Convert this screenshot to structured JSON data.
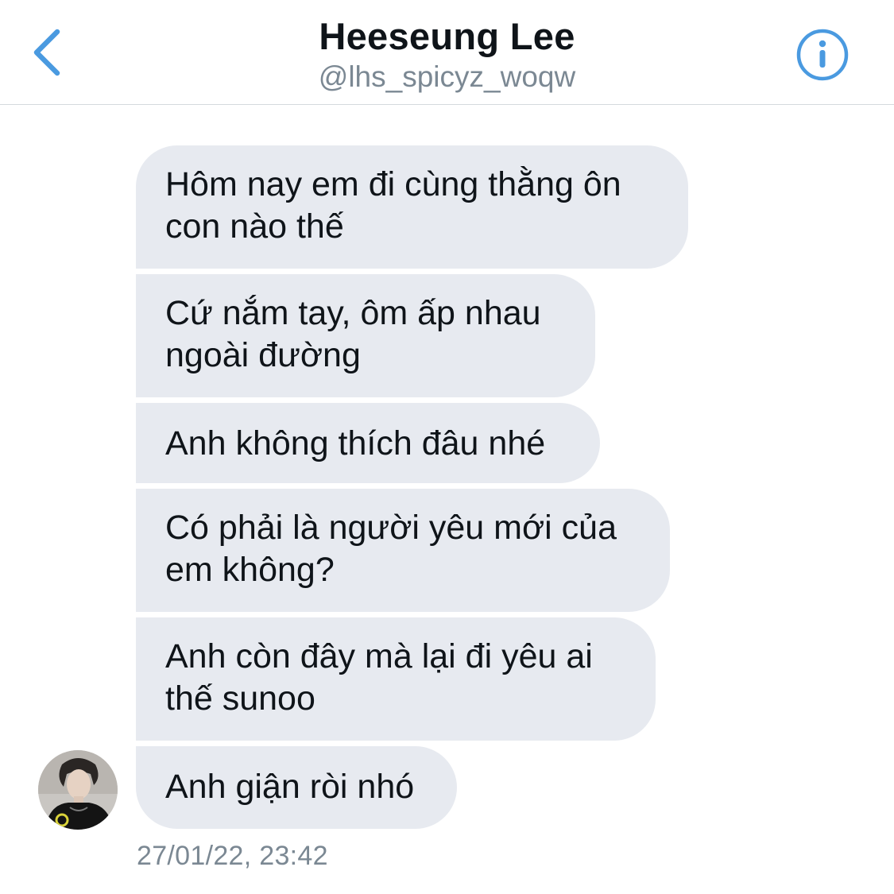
{
  "header": {
    "title": "Heeseung Lee",
    "handle": "@lhs_spicyz_woqw",
    "back_icon": "chevron-left-icon",
    "info_icon": "info-circle-icon",
    "accent_color": "#4a9ae0"
  },
  "messages": [
    {
      "line1": "Hôm nay em đi cùng thằng ôn",
      "line2": "con nào thế"
    },
    {
      "line1": "Cứ nắm tay, ôm ấp nhau",
      "line2": "ngoài đường"
    },
    {
      "line1": "Anh không thích đâu nhé"
    },
    {
      "line1": "Có phải là người yêu mới của",
      "line2": "em không?"
    },
    {
      "line1": "Anh còn đây mà lại đi yêu ai",
      "line2": "thế sunoo"
    },
    {
      "line1": "Anh giận ròi nhó"
    }
  ],
  "timestamp": "27/01/22, 23:42",
  "colors": {
    "bubble_bg": "#e7eaf0",
    "text": "#0f1419",
    "muted": "#7b8893",
    "divider": "#d5d9dd"
  }
}
